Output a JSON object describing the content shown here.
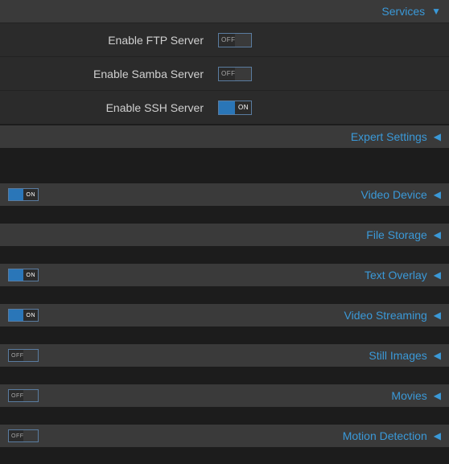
{
  "services": {
    "title": "Services",
    "expanded": true,
    "items": [
      {
        "label": "Enable FTP Server",
        "state": "OFF"
      },
      {
        "label": "Enable Samba Server",
        "state": "OFF"
      },
      {
        "label": "Enable SSH Server",
        "state": "ON"
      }
    ]
  },
  "expert": {
    "title": "Expert Settings"
  },
  "sections": [
    {
      "title": "Video Device",
      "toggle": "ON"
    },
    {
      "title": "File Storage",
      "toggle": null
    },
    {
      "title": "Text Overlay",
      "toggle": "ON"
    },
    {
      "title": "Video Streaming",
      "toggle": "ON"
    },
    {
      "title": "Still Images",
      "toggle": "OFF"
    },
    {
      "title": "Movies",
      "toggle": "OFF"
    },
    {
      "title": "Motion Detection",
      "toggle": "OFF"
    }
  ],
  "glyphs": {
    "down": "▼",
    "left": "◀"
  }
}
